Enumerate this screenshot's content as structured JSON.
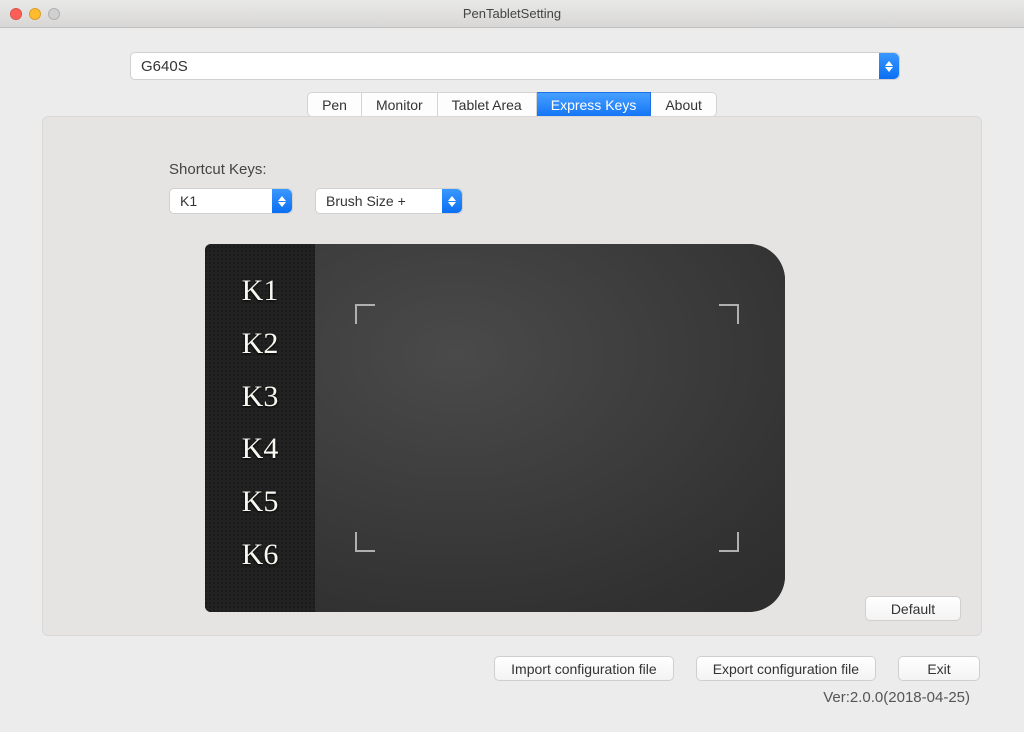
{
  "window": {
    "title": "PenTabletSetting"
  },
  "deviceSelect": {
    "value": "G640S"
  },
  "tabs": [
    {
      "label": "Pen"
    },
    {
      "label": "Monitor"
    },
    {
      "label": "Tablet Area"
    },
    {
      "label": "Express Keys"
    },
    {
      "label": "About"
    }
  ],
  "activeTabIndex": 3,
  "shortcut": {
    "label": "Shortcut Keys:",
    "keySelect": "K1",
    "functionSelect": "Brush Size +"
  },
  "tablet": {
    "keys": [
      "K1",
      "K2",
      "K3",
      "K4",
      "K5",
      "K6"
    ]
  },
  "buttons": {
    "default": "Default",
    "import": "Import configuration file",
    "export": "Export configuration file",
    "exit": "Exit"
  },
  "version": "Ver:2.0.0(2018-04-25)"
}
